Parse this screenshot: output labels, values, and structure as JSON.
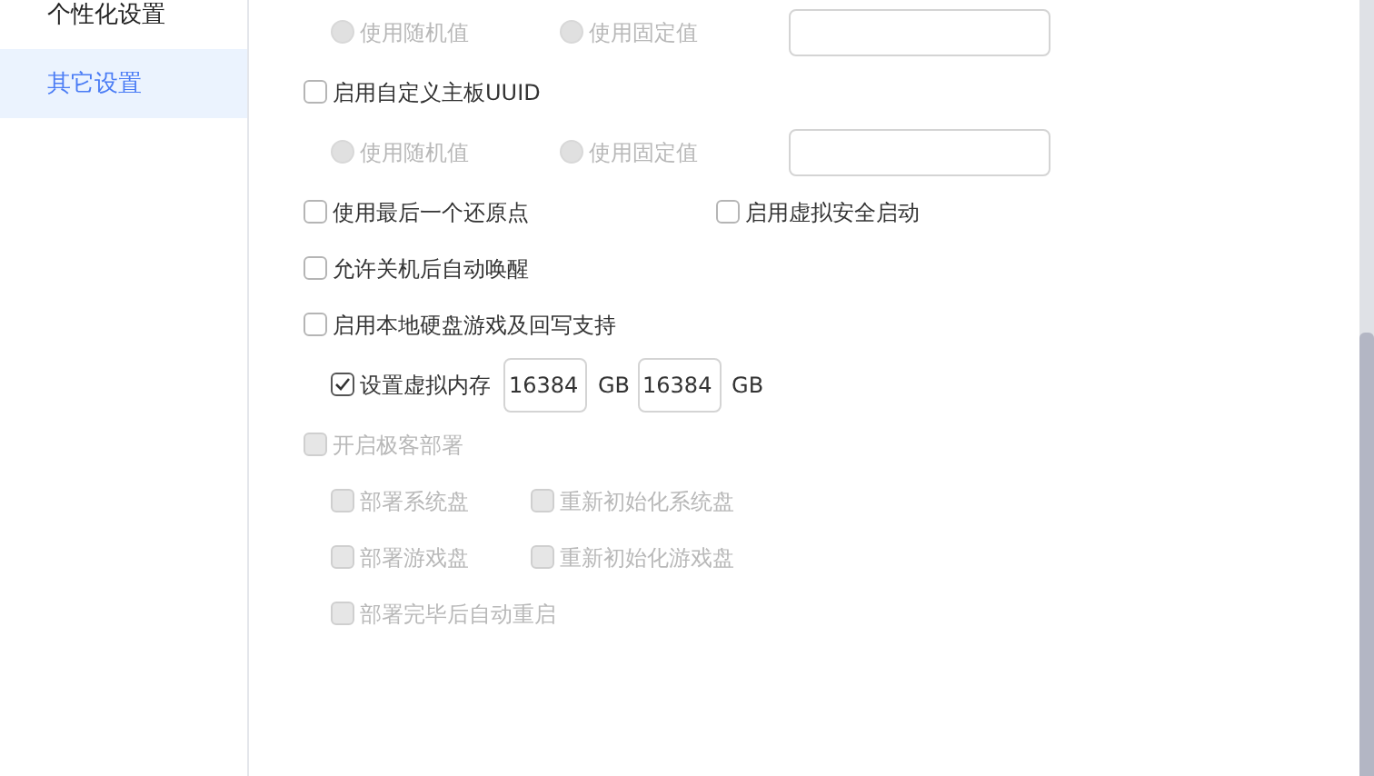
{
  "sidebar": {
    "items": [
      {
        "label": "个性化设置",
        "selected": false
      },
      {
        "label": "其它设置",
        "selected": true
      }
    ]
  },
  "settings": [
    {
      "kind": "radios",
      "options": [
        {
          "label": "使用随机值",
          "selected": false,
          "disabled": true
        },
        {
          "label": "使用固定值",
          "selected": false,
          "disabled": true
        }
      ]
    },
    {
      "kind": "checks",
      "items": [
        {
          "label": "启用自定义主板UUID",
          "checked": false,
          "disabled": false
        }
      ]
    },
    {
      "kind": "radios",
      "options": [
        {
          "label": "使用随机值",
          "selected": false,
          "disabled": true
        },
        {
          "label": "使用固定值",
          "selected": false,
          "disabled": true
        }
      ]
    },
    {
      "kind": "checks",
      "items": [
        {
          "label": "使用最后一个还原点",
          "checked": false,
          "disabled": false
        },
        {
          "label": "启用虚拟安全启动",
          "checked": false,
          "disabled": false
        }
      ]
    },
    {
      "kind": "checks",
      "items": [
        {
          "label": "允许关机后自动唤醒",
          "checked": false,
          "disabled": false
        }
      ]
    },
    {
      "kind": "checks",
      "items": [
        {
          "label": "启用本地硬盘游戏及回写支持",
          "checked": false,
          "disabled": false
        }
      ],
      "children": [
        {
          "kind": "memory",
          "checkbox": {
            "label": "设置虚拟内存",
            "checked": true
          },
          "fields": [
            {
              "value": "16384",
              "unit": "GB"
            },
            {
              "value": "16384",
              "unit": "GB"
            }
          ]
        }
      ]
    },
    {
      "kind": "checks",
      "items": [
        {
          "label": "开启极客部署",
          "checked": false,
          "disabled": true
        }
      ],
      "children": [
        {
          "kind": "checks",
          "items": [
            {
              "label": "部署系统盘",
              "checked": false,
              "disabled": true
            },
            {
              "label": "重新初始化系统盘",
              "checked": false,
              "disabled": true
            }
          ]
        },
        {
          "kind": "checks",
          "items": [
            {
              "label": "部署游戏盘",
              "checked": false,
              "disabled": true
            },
            {
              "label": "重新初始化游戏盘",
              "checked": false,
              "disabled": true
            }
          ]
        },
        {
          "kind": "checks",
          "items": [
            {
              "label": "部署完毕后自动重启",
              "checked": false,
              "disabled": true
            }
          ]
        }
      ]
    }
  ]
}
